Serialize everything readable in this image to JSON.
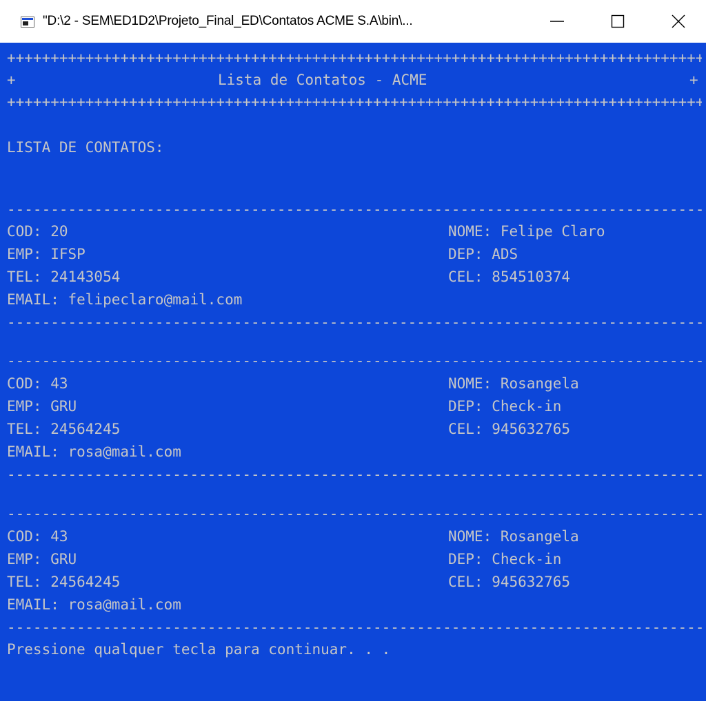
{
  "window": {
    "title": "\"D:\\2 - SEM\\ED1D2\\Projeto_Final_ED\\Contatos ACME S.A\\bin\\...",
    "minimize_icon": "minimize-icon",
    "maximize_icon": "maximize-icon",
    "close_icon": "close-icon"
  },
  "console": {
    "plus_border": "+++++++++++++++++++++++++++++++++++++++++++++++++++++++++++++++++++++++++++++++++++++++++++++",
    "plus_char": "+",
    "header_title": "Lista de Contatos - ACME",
    "list_heading": "LISTA DE CONTATOS:",
    "dash_line": "-------------------------------------------------------------------------------------------------",
    "contacts": [
      {
        "cod": "COD: 20",
        "nome": "NOME: Felipe Claro",
        "emp": "EMP: IFSP",
        "dep": "DEP: ADS",
        "tel": "TEL: 24143054",
        "cel": "CEL: 854510374",
        "email": "EMAIL: felipeclaro@mail.com"
      },
      {
        "cod": "COD: 43",
        "nome": "NOME: Rosangela",
        "emp": "EMP: GRU",
        "dep": "DEP: Check-in",
        "tel": "TEL: 24564245",
        "cel": "CEL: 945632765",
        "email": "EMAIL: rosa@mail.com"
      },
      {
        "cod": "COD: 43",
        "nome": "NOME: Rosangela",
        "emp": "EMP: GRU",
        "dep": "DEP: Check-in",
        "tel": "TEL: 24564245",
        "cel": "CEL: 945632765",
        "email": "EMAIL: rosa@mail.com"
      }
    ],
    "prompt": "Pressione qualquer tecla para continuar. . ."
  },
  "colors": {
    "console_background": "#0d47d9",
    "console_text": "#c6c6c6",
    "titlebar_background": "#ffffff"
  }
}
